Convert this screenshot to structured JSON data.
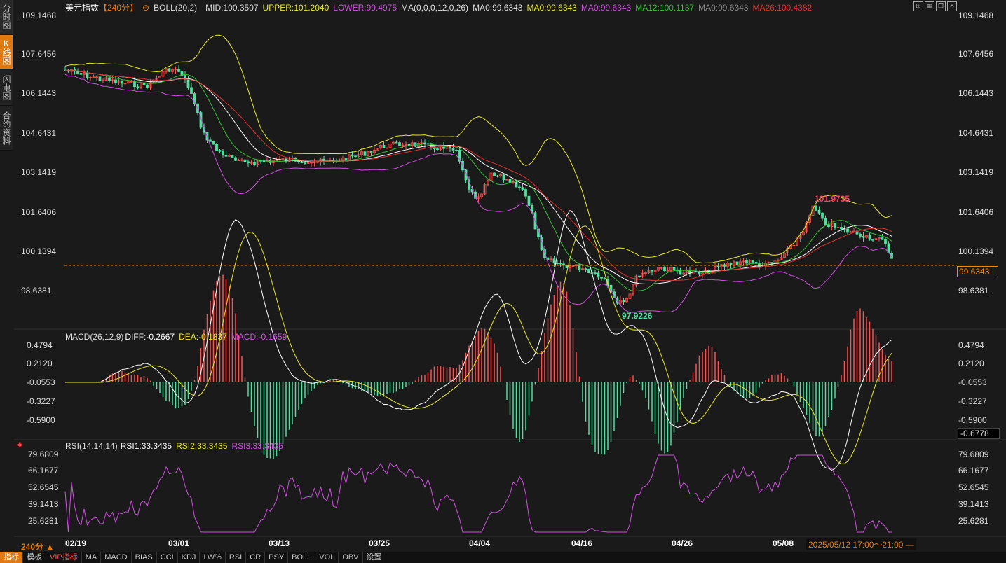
{
  "side_tabs": [
    {
      "label": "分时图",
      "active": false
    },
    {
      "label": "K线图",
      "active": true
    },
    {
      "label": "闪电图",
      "active": false
    },
    {
      "label": "合约资料",
      "active": false
    }
  ],
  "header": {
    "symbol": "美元指数",
    "period": "【240分】",
    "boll_label": "BOLL(20,2)",
    "boll_mid": "MID:100.3507",
    "boll_upper": "UPPER:101.2040",
    "boll_lower": "LOWER:99.4975",
    "ma_label": "MA(0,0,0,12,0,26)",
    "ma0a": "MA0:99.6343",
    "ma0b": "MA0:99.6343",
    "ma0c": "MA0:99.6343",
    "ma12": "MA12:100.1137",
    "ma0d": "MA0:99.6343",
    "ma26": "MA26:100.4382"
  },
  "price_axis": {
    "ticks": [
      "109.1468",
      "107.6456",
      "106.1443",
      "104.6431",
      "103.1419",
      "101.6406",
      "100.1394",
      "98.6381"
    ],
    "current": "99.6343",
    "high_label": "101.9735",
    "low_label": "97.9226"
  },
  "macd": {
    "label": "MACD(26,12,9)",
    "diff": "DIFF:-0.2667",
    "dea": "DEA:-0.1837",
    "macd": "MACD:-0.1659",
    "ticks": [
      "0.4794",
      "0.2120",
      "-0.0553",
      "-0.3227",
      "-0.5900"
    ],
    "current": "-0.6778"
  },
  "rsi": {
    "label": "RSI(14,14,14)",
    "rsi1": "RSI1:33.3435",
    "rsi2": "RSI2:33.3435",
    "rsi3": "RSI3:33.3435",
    "ticks": [
      "79.6809",
      "66.1677",
      "52.6545",
      "39.1413",
      "25.6281"
    ]
  },
  "x_axis": {
    "period_btn": "240分 ▲",
    "dates": [
      "02/19",
      "03/01",
      "03/13",
      "03/25",
      "04/04",
      "04/16",
      "04/26",
      "05/08"
    ],
    "range": "2025/05/12 17:00～21:00 —"
  },
  "toolbar": [
    "指标",
    "模板",
    "VIP指标",
    "MA",
    "MACD",
    "BIAS",
    "CCI",
    "KDJ",
    "LW%",
    "RSI",
    "CR",
    "PSY",
    "BOLL",
    "VOL",
    "OBV",
    "设置"
  ],
  "colors": {
    "upper": "#e8e82a",
    "mid": "#ffffff",
    "lower": "#d050e0",
    "ma12": "#30c030",
    "ma26": "#e03030",
    "up": "#ff5050",
    "down": "#50e0a0",
    "accent": "#e07a10",
    "current": "#ff8800",
    "label_high": "#ff4060",
    "label_low": "#50e0a0"
  }
}
